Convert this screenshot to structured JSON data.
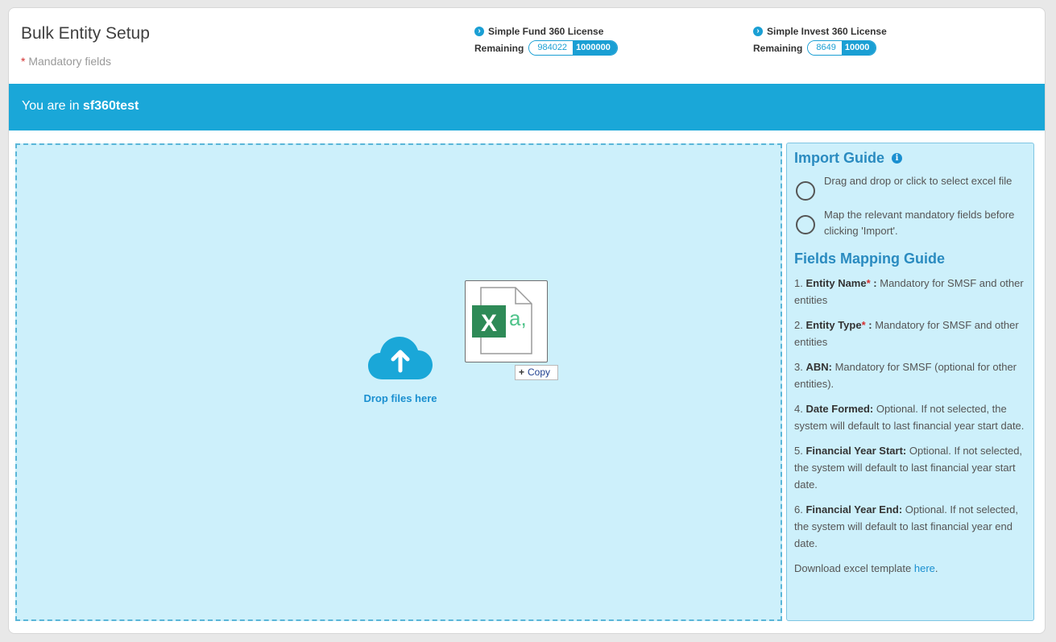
{
  "page": {
    "title": "Bulk Entity Setup",
    "mandatory_star": "*",
    "mandatory_text": " Mandatory fields"
  },
  "licenses": [
    {
      "title": "Simple Fund 360 License",
      "remaining_label": "Remaining",
      "used": "984022",
      "total": "1000000"
    },
    {
      "title": "Simple Invest 360 License",
      "remaining_label": "Remaining",
      "used": "8649",
      "total": "10000"
    }
  ],
  "banner": {
    "prefix": "You are in ",
    "workspace": "sf360test"
  },
  "dropzone": {
    "label": "Drop files here",
    "drag_action": "Copy",
    "file_icon_letter": "X",
    "file_icon_text": "a,"
  },
  "import_guide": {
    "title": "Import Guide",
    "steps": [
      "Drag and drop or click to select excel file",
      "Map the relevant mandatory fields before clicking 'Import'."
    ]
  },
  "mapping_guide": {
    "title": "Fields Mapping Guide",
    "fields": [
      {
        "num": "1.",
        "name": "Entity Name",
        "req": "*",
        "sep": " :",
        "desc": " Mandatory for SMSF and other entities"
      },
      {
        "num": "2.",
        "name": "Entity Type",
        "req": "*",
        "sep": " :",
        "desc": " Mandatory for SMSF and other entities"
      },
      {
        "num": "3.",
        "name": "ABN:",
        "req": "",
        "sep": "",
        "desc": " Mandatory for SMSF (optional for other entities)."
      },
      {
        "num": "4.",
        "name": "Date Formed:",
        "req": "",
        "sep": "",
        "desc": " Optional. If not selected, the system will default to last financial year start date."
      },
      {
        "num": "5.",
        "name": "Financial Year Start:",
        "req": "",
        "sep": "",
        "desc": " Optional. If not selected, the system will default to last financial year start date."
      },
      {
        "num": "6.",
        "name": "Financial Year End:",
        "req": "",
        "sep": "",
        "desc": " Optional. If not selected, the system will default to last financial year end date."
      }
    ],
    "download_text": "Download excel template ",
    "download_link": "here",
    "download_suffix": "."
  },
  "colors": {
    "accent": "#1aa7d8",
    "drop_bg": "#cdf0fb",
    "link": "#1a8fd0",
    "required": "#d32f2f"
  }
}
